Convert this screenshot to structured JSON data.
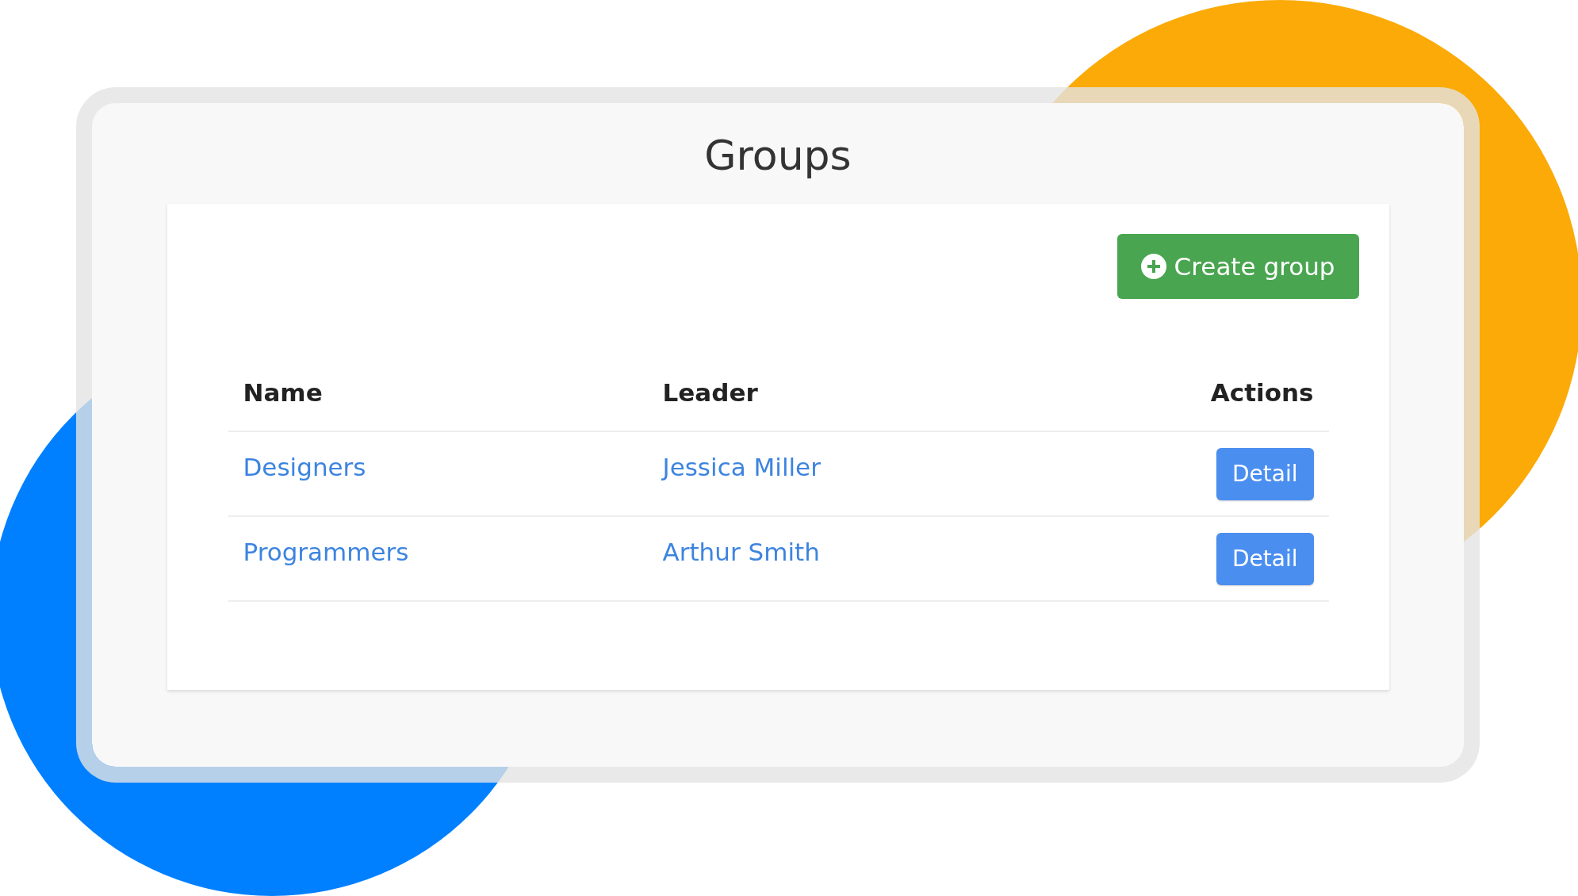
{
  "title": "Groups",
  "create_button": {
    "label": "Create group"
  },
  "table": {
    "columns": [
      "Name",
      "Leader",
      "Actions"
    ],
    "rows": [
      {
        "name": "Designers",
        "leader": "Jessica Miller",
        "action": "Detail"
      },
      {
        "name": "Programmers",
        "leader": "Arthur Smith",
        "action": "Detail"
      }
    ]
  }
}
